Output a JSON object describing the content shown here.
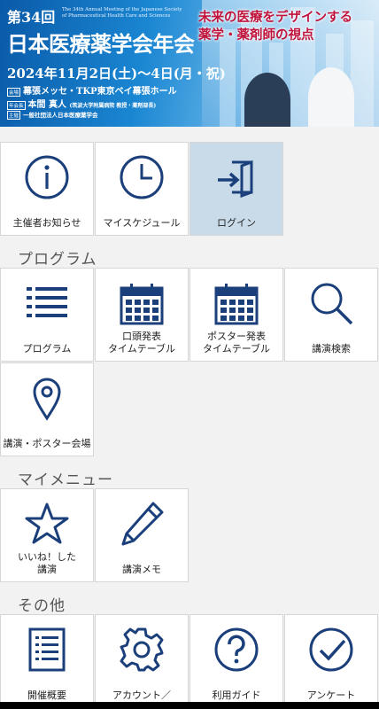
{
  "banner": {
    "edition": "第34回",
    "english_title": "The 34th Annual Meeting of the Japanese Society of Pharmaceutical Health Care and Sciences",
    "title": "日本医療薬学会年会",
    "catchphrase_1": "未来の医療をデザインする",
    "catchphrase_2": "薬学・薬剤師の視点",
    "date": "2024年11月2日(土)～4日(月・祝)",
    "venue_tag": "会場",
    "venue": "幕張メッセ・TKP東京ベイ幕張ホール",
    "chair_tag": "年会長",
    "chair": "本間 真人",
    "chair_affiliation": "(筑波大学附属病院 教授・薬剤部長)",
    "host_tag": "主催",
    "host": "一般社団法人日本医療薬学会"
  },
  "top_tiles": [
    {
      "label": "主催者お知らせ",
      "icon": "info-icon"
    },
    {
      "label": "マイスケジュール",
      "icon": "clock-icon"
    },
    {
      "label": "ログイン",
      "icon": "login-icon"
    }
  ],
  "sections": {
    "program": "プログラム",
    "mymenu": "マイメニュー",
    "other": "その他"
  },
  "program_tiles": [
    {
      "label": "プログラム",
      "icon": "list-icon"
    },
    {
      "label": "口頭発表\nタイムテーブル",
      "icon": "calendar-icon"
    },
    {
      "label": "ポスター発表\nタイムテーブル",
      "icon": "calendar-icon"
    },
    {
      "label": "講演検索",
      "icon": "search-icon"
    },
    {
      "label": "講演・ポスター会場",
      "icon": "map-pin-icon"
    }
  ],
  "mymenu_tiles": [
    {
      "label": "いいね！した\n講演",
      "icon": "star-icon"
    },
    {
      "label": "講演メモ",
      "icon": "pencil-icon"
    }
  ],
  "other_tiles": [
    {
      "label": "開催概要",
      "icon": "document-icon"
    },
    {
      "label": "アカウント／",
      "icon": "gear-icon"
    },
    {
      "label": "利用ガイド",
      "icon": "help-icon"
    },
    {
      "label": "アンケート",
      "icon": "check-circle-icon"
    }
  ],
  "colors": {
    "icon": "#1b3f7a",
    "active_tile": "#c9dbe9",
    "catch_red": "#c0143c"
  }
}
